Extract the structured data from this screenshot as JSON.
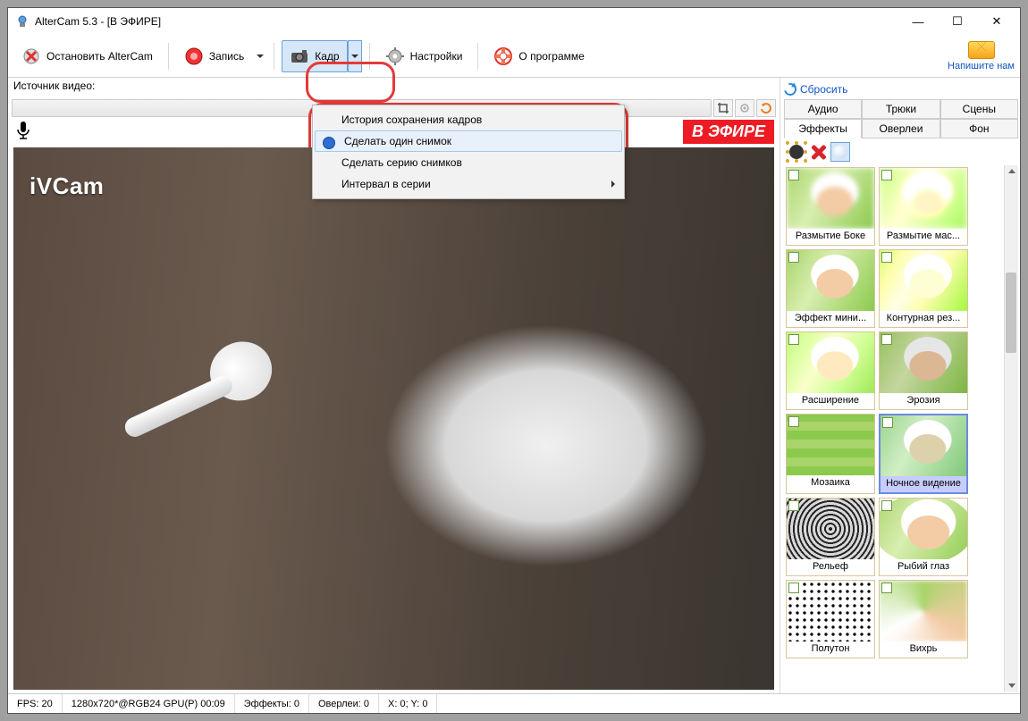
{
  "window": {
    "title": "AlterCam 5.3 - [В ЭФИРЕ]"
  },
  "toolbar": {
    "stop": "Остановить AlterCam",
    "record": "Запись",
    "frame": "Кадр",
    "settings": "Настройки",
    "about": "О программе",
    "contact": "Напишите нам"
  },
  "frame_menu": {
    "history": "История сохранения кадров",
    "single": "Сделать один снимок",
    "series": "Сделать серию снимков",
    "interval": "Интервал в серии"
  },
  "left": {
    "source_label": "Источник видео:",
    "live_badge": "В ЭФИРЕ",
    "watermark": "iVCam"
  },
  "right": {
    "reset": "Сбросить",
    "tabs_row1": {
      "audio": "Аудио",
      "tricks": "Трюки",
      "scenes": "Сцены"
    },
    "tabs_row2": {
      "effects": "Эффекты",
      "overlays": "Оверлеи",
      "bg": "Фон"
    },
    "effects": [
      "Размытие Боке",
      "Размытие мас...",
      "Эффект мини...",
      "Контурная рез...",
      "Расширение",
      "Эрозия",
      "Мозаика",
      "Ночное видение",
      "Рельеф",
      "Рыбий глаз",
      "Полутон",
      "Вихрь"
    ]
  },
  "status": {
    "fps": "FPS: 20",
    "res": "1280x720*@RGB24 GPU(P) 00:09",
    "effects": "Эффекты: 0",
    "overlays": "Оверлеи: 0",
    "coords": "X: 0; Y: 0"
  }
}
